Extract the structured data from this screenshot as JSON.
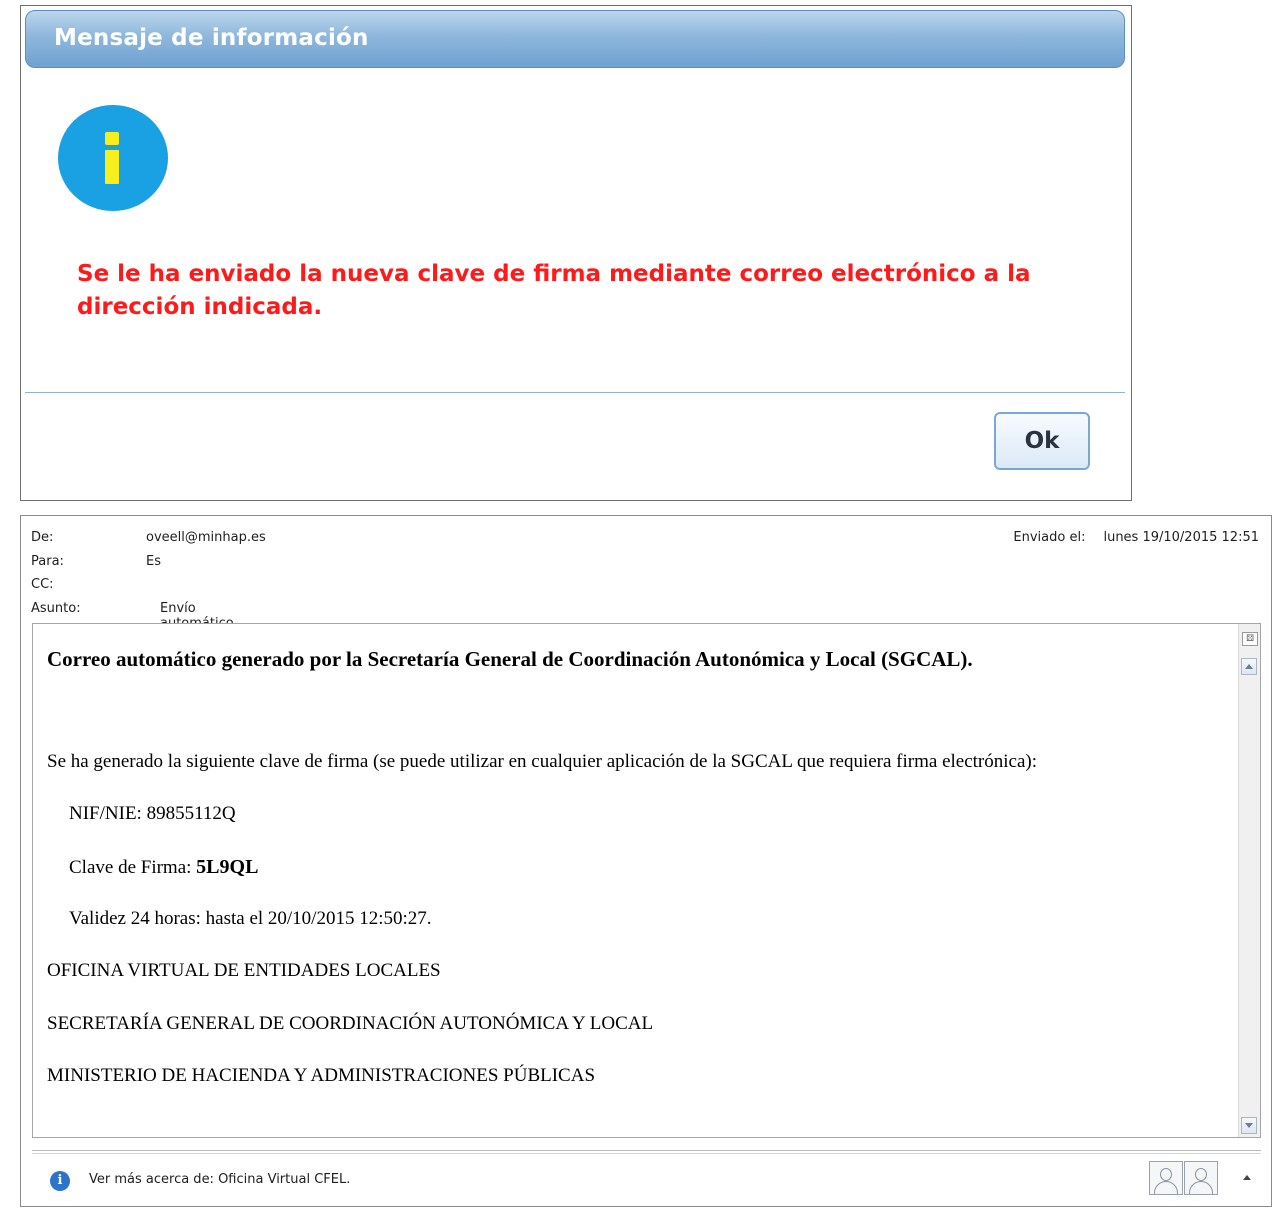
{
  "dialog": {
    "title": "Mensaje de información",
    "icon": "info-icon",
    "message": "Se le ha enviado la nueva clave de firma mediante correo electrónico a la dirección indicada.",
    "ok_label": "Ok",
    "colors": {
      "message": "#ff1a1a",
      "icon_circle": "#1aa1e3",
      "icon_glyph": "#f7ef1d"
    }
  },
  "email": {
    "headers": [
      {
        "label": "De:",
        "value": "oveell@minhap.es"
      },
      {
        "label": "Para:",
        "value": "Es"
      },
      {
        "label": "CC:",
        "value": ""
      },
      {
        "label": "Asunto:",
        "value": "Envío automático de clave de firma de la SGCAL"
      }
    ],
    "sent": {
      "label": "Enviado el:",
      "value": "lunes 19/10/2015 12:51"
    },
    "body": {
      "heading": "Correo automático generado por la Secretaría General de Coordinación Autonómica y Local (SGCAL).",
      "intro": "Se ha generado la siguiente clave de firma (se puede utilizar en cualquier aplicación de la SGCAL que requiera firma electrónica):",
      "nif_label": "NIF/NIE:",
      "nif_value": "89855112Q",
      "clave_label": "Clave de Firma:",
      "clave_value": "5L9QL",
      "validity": "Validez 24 horas: hasta el 20/10/2015 12:50:27.",
      "org_lines": [
        "OFICINA VIRTUAL DE ENTIDADES LOCALES",
        "SECRETARÍA GENERAL DE COORDINACIÓN AUTONÓMICA Y LOCAL",
        "MINISTERIO DE HACIENDA Y ADMINISTRACIONES PÚBLICAS"
      ]
    },
    "footer": {
      "text": "Ver más acerca de: Oficina Virtual CFEL.",
      "info_glyph": "i"
    }
  }
}
